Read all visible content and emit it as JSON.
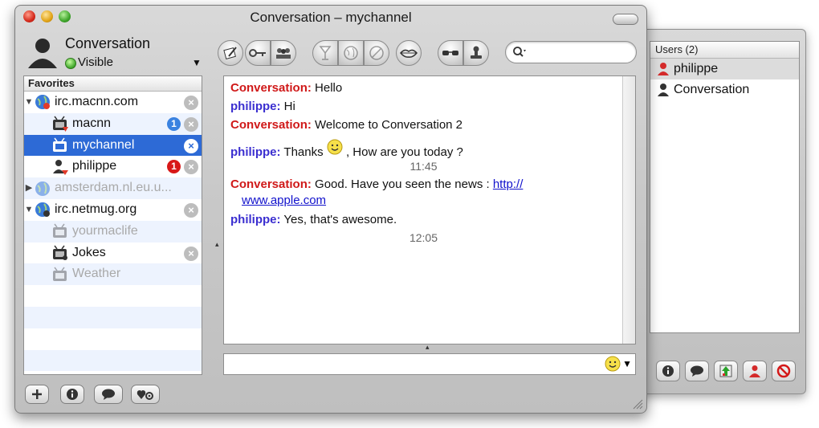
{
  "window": {
    "title": "Conversation – mychannel"
  },
  "identity": {
    "name": "Conversation",
    "status": "Visible"
  },
  "search": {
    "placeholder": ""
  },
  "sidebar": {
    "header": "Favorites",
    "items": [
      {
        "label": "irc.macnn.com",
        "kind": "server",
        "expanded": true,
        "state": "normal",
        "closable": true
      },
      {
        "label": "macnn",
        "kind": "channel",
        "state": "normal",
        "badge": "1",
        "badge_color": "#3a82e0",
        "closable": true
      },
      {
        "label": "mychannel",
        "kind": "channel",
        "state": "selected",
        "closable": true
      },
      {
        "label": "philippe",
        "kind": "user",
        "state": "normal",
        "badge": "1",
        "badge_color": "#d81818",
        "closable": true
      },
      {
        "label": "amsterdam.nl.eu.u...",
        "kind": "server",
        "expanded": false,
        "state": "disabled",
        "closable": false
      },
      {
        "label": "irc.netmug.org",
        "kind": "server",
        "expanded": true,
        "state": "normal",
        "closable": true
      },
      {
        "label": "yourmaclife",
        "kind": "channel",
        "state": "disabled",
        "closable": false
      },
      {
        "label": "Jokes",
        "kind": "channel",
        "state": "normal",
        "closable": true
      },
      {
        "label": "Weather",
        "kind": "channel",
        "state": "disabled",
        "closable": false
      }
    ]
  },
  "chat": {
    "messages": [
      {
        "nick": "Conversation:",
        "color": "red",
        "text": "Hello"
      },
      {
        "nick": "philippe:",
        "color": "blue",
        "text": "Hi"
      },
      {
        "nick": "Conversation:",
        "color": "red",
        "text": "Welcome to Conversation 2"
      },
      {
        "nick": "philippe:",
        "color": "blue",
        "text_before": "Thanks",
        "text_after": ", How are you today ?"
      },
      {
        "nick": "Conversation:",
        "color": "red",
        "text": "Good. Have you seen the news :",
        "link_part1": "http://",
        "link_part2": "www.apple.com"
      },
      {
        "nick": "philippe:",
        "color": "blue",
        "text": "Yes, that's awesome."
      }
    ],
    "timestamps": [
      "11:45",
      "12:05"
    ]
  },
  "users": {
    "header": "Users (2)",
    "items": [
      {
        "name": "philippe",
        "selected": true,
        "icon": "user-red-icon"
      },
      {
        "name": "Conversation",
        "selected": false,
        "icon": "user-dark-icon"
      }
    ]
  },
  "toolbar_icons": [
    "edit-topic-icon",
    "key-icon",
    "members-icon",
    "drink-icon",
    "globe-icon",
    "tools-icon",
    "lips-icon",
    "glasses-icon",
    "stamp-icon"
  ],
  "bottom_toolbar_icons": [
    "add-icon",
    "info-icon",
    "chat-bubble-icon",
    "favorites-settings-icon"
  ],
  "drawer_toolbar_icons": [
    "info-icon",
    "chat-bubble-icon",
    "op-icon",
    "user-icon",
    "ban-icon"
  ],
  "colors": {
    "selection": "#2d6ad6",
    "nick_red": "#d01919",
    "nick_blue": "#3b2fd0",
    "stripe": "#edf3fe"
  }
}
